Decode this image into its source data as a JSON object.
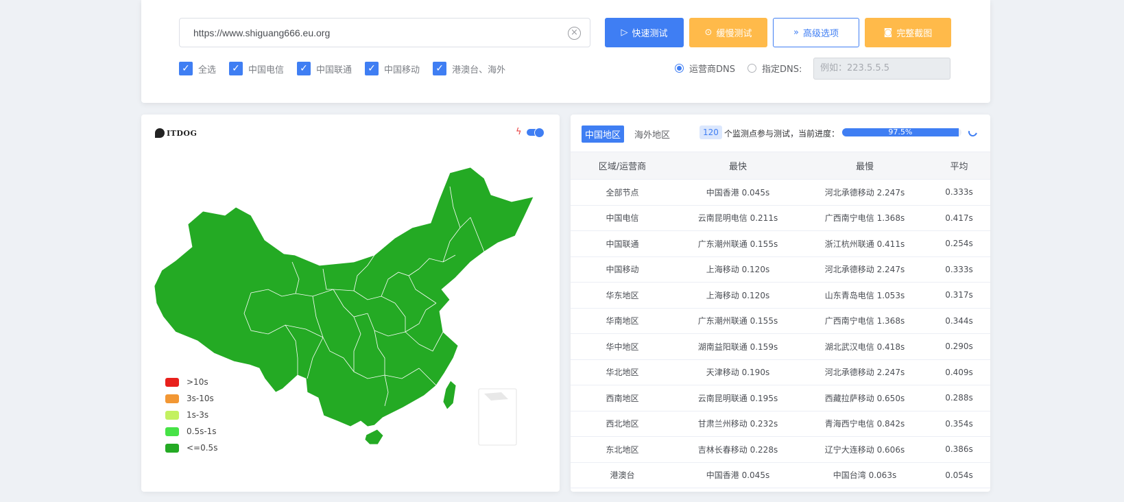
{
  "search": {
    "url": "https://www.shiguang666.eu.org",
    "clear_icon": "close-circle-icon"
  },
  "actions": {
    "fast_test": "快速测试",
    "slow_test": "缓慢测试",
    "advanced": "高级选项",
    "screenshot": "完整截图"
  },
  "filters": [
    {
      "label": "全选",
      "checked": true
    },
    {
      "label": "中国电信",
      "checked": true
    },
    {
      "label": "中国联通",
      "checked": true
    },
    {
      "label": "中国移动",
      "checked": true
    },
    {
      "label": "港澳台、海外",
      "checked": true
    }
  ],
  "dns": {
    "isp_label": "运营商DNS",
    "custom_label": "指定DNS:",
    "custom_placeholder": "例如：223.5.5.5",
    "selected": "isp"
  },
  "map": {
    "logo_text": "ITDOG",
    "fill_color": "#24aa24",
    "legend": [
      {
        "label": ">10s",
        "color": "#e8201c"
      },
      {
        "label": "3s-10s",
        "color": "#f29734"
      },
      {
        "label": "1s-3s",
        "color": "#c3f161"
      },
      {
        "label": "0.5s-1s",
        "color": "#46e246"
      },
      {
        "label": "<=0.5s",
        "color": "#24aa24"
      }
    ]
  },
  "results": {
    "tabs": [
      "中国地区",
      "海外地区"
    ],
    "active_tab": 0,
    "node_count": "120",
    "count_text": "个监测点参与测试，当前进度：",
    "progress": "97.5%",
    "progress_value": 97.5,
    "columns": [
      "区域/运营商",
      "最快",
      "最慢",
      "平均"
    ],
    "rows": [
      [
        "全部节点",
        "中国香港 0.045s",
        "河北承德移动 2.247s",
        "0.333s"
      ],
      [
        "中国电信",
        "云南昆明电信 0.211s",
        "广西南宁电信 1.368s",
        "0.417s"
      ],
      [
        "中国联通",
        "广东潮州联通 0.155s",
        "浙江杭州联通 0.411s",
        "0.254s"
      ],
      [
        "中国移动",
        "上海移动 0.120s",
        "河北承德移动 2.247s",
        "0.333s"
      ],
      [
        "华东地区",
        "上海移动 0.120s",
        "山东青岛电信 1.053s",
        "0.317s"
      ],
      [
        "华南地区",
        "广东潮州联通 0.155s",
        "广西南宁电信 1.368s",
        "0.344s"
      ],
      [
        "华中地区",
        "湖南益阳联通 0.159s",
        "湖北武汉电信 0.418s",
        "0.290s"
      ],
      [
        "华北地区",
        "天津移动 0.190s",
        "河北承德移动 2.247s",
        "0.409s"
      ],
      [
        "西南地区",
        "云南昆明联通 0.195s",
        "西藏拉萨移动 0.650s",
        "0.288s"
      ],
      [
        "西北地区",
        "甘肃兰州移动 0.232s",
        "青海西宁电信 0.842s",
        "0.354s"
      ],
      [
        "东北地区",
        "吉林长春移动 0.228s",
        "辽宁大连移动 0.606s",
        "0.386s"
      ],
      [
        "港澳台",
        "中国香港 0.045s",
        "中国台湾 0.063s",
        "0.054s"
      ]
    ]
  }
}
